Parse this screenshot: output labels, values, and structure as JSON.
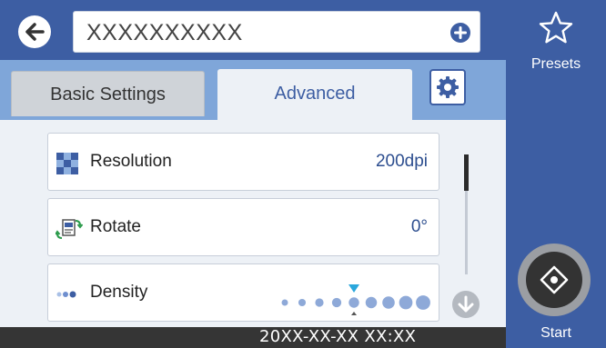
{
  "header": {
    "back_icon": "arrow-left-icon",
    "destination_text": "XXXXXXXXXX",
    "add_icon": "plus-circle-icon"
  },
  "tabs": {
    "basic_label": "Basic Settings",
    "advanced_label": "Advanced",
    "active": "Advanced",
    "settings_icon": "gear-icon"
  },
  "settings": [
    {
      "label": "Resolution",
      "value": "200dpi",
      "icon": "resolution-icon"
    },
    {
      "label": "Rotate",
      "value": "0°",
      "icon": "rotate-icon"
    },
    {
      "label": "Density",
      "icon": "density-icon",
      "level": 0,
      "min": -4,
      "max": 4
    }
  ],
  "sidebar": {
    "presets_label": "Presets",
    "presets_icon": "star-icon",
    "start_label": "Start",
    "start_icon": "start-diamond-icon"
  },
  "status": {
    "datetime": "20XX-XX-XX XX:XX"
  },
  "scroll_icon": "arrow-down-icon",
  "colors": {
    "primary": "#3d5ea3",
    "tab_bar": "#7fa6d9",
    "content_bg": "#edf1f6",
    "value_text": "#2d4e8f",
    "density_dot": "#8ea9d8",
    "density_marker": "#2aa7dc"
  }
}
